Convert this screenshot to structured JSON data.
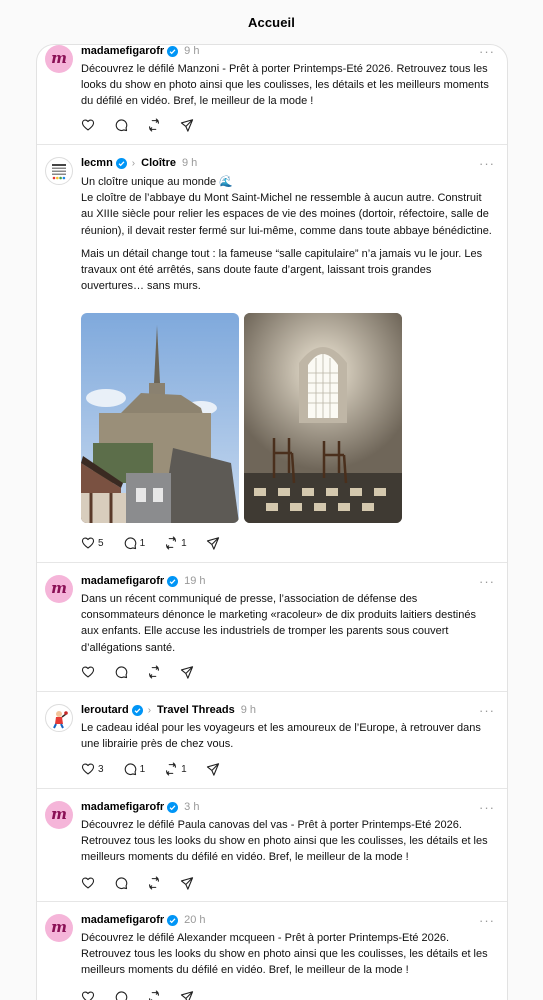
{
  "header": {
    "title": "Accueil"
  },
  "posts": [
    {
      "username": "madamefigarofr",
      "time": "9 h",
      "more": "···",
      "text": "Découvrez le défilé Manzoni - Prêt à porter Printemps-Eté 2026. Retrouvez tous les looks du show en photo ainsi que les coulisses, les détails et les meilleurs moments du défilé en vidéo. Bref, le meilleur de la mode !",
      "actions": {
        "likes": "",
        "replies": "",
        "reposts": ""
      }
    },
    {
      "username": "lecmn",
      "topic": "Cloître",
      "time": "9 h",
      "more": "···",
      "paragraph1": "Un cloître unique au monde 🌊\nLe cloître de l’abbaye du Mont Saint-Michel ne ressemble à aucun autre. Construit au XIIIe siècle pour relier les espaces de vie des moines (dortoir, réfectoire, salle de réunion), il devait rester fermé sur lui-même, comme dans toute abbaye bénédictine.",
      "paragraph2": "Mais un détail change tout : la fameuse “salle capitulaire” n’a jamais vu le jour. Les travaux ont été arrêtés, sans doute faute d’argent, laissant trois grandes ouvertures… sans murs.",
      "images": [
        "Mont Saint-Michel abbey",
        "Arched window with two chairs"
      ],
      "actions": {
        "likes": "5",
        "replies": "1",
        "reposts": "1"
      }
    },
    {
      "username": "madamefigarofr",
      "time": "19 h",
      "more": "···",
      "text": "Dans un récent communiqué de presse, l’association de défense des consommateurs dénonce le marketing «racoleur» de dix produits laitiers destinés aux enfants. Elle accuse les industriels de tromper les parents sous couvert d’allégations santé.",
      "actions": {
        "likes": "",
        "replies": "",
        "reposts": ""
      }
    },
    {
      "username": "leroutard",
      "topic": "Travel Threads",
      "time": "9 h",
      "more": "···",
      "text": "Le cadeau idéal pour les voyageurs et les amoureux de l’Europe, à retrouver dans une librairie près de chez vous.",
      "actions": {
        "likes": "3",
        "replies": "1",
        "reposts": "1"
      }
    },
    {
      "username": "madamefigarofr",
      "time": "3 h",
      "more": "···",
      "text": "Découvrez le défilé Paula canovas del vas - Prêt à porter Printemps-Eté 2026. Retrouvez tous les looks du show en photo ainsi que les coulisses, les détails et les meilleurs moments du défilé en vidéo. Bref, le meilleur de la mode !",
      "actions": {
        "likes": "",
        "replies": "",
        "reposts": ""
      }
    },
    {
      "username": "madamefigarofr",
      "time": "20 h",
      "more": "···",
      "text": "Découvrez le défilé Alexander mcqueen - Prêt à porter Printemps-Eté 2026. Retrouvez tous les looks du show en photo ainsi que les coulisses, les détails et les meilleurs moments du défilé en vidéo. Bref, le meilleur de la mode !",
      "actions": {
        "likes": "",
        "replies": "",
        "reposts": ""
      }
    }
  ],
  "icons": {
    "verified": "verified-badge-icon",
    "like": "heart-icon",
    "reply": "comment-icon",
    "repost": "repost-icon",
    "share": "send-icon"
  },
  "colors": {
    "verified": "#0095f6",
    "figaro_avatar": "#f5b5d9",
    "figaro_mark": "#8a0f55"
  }
}
